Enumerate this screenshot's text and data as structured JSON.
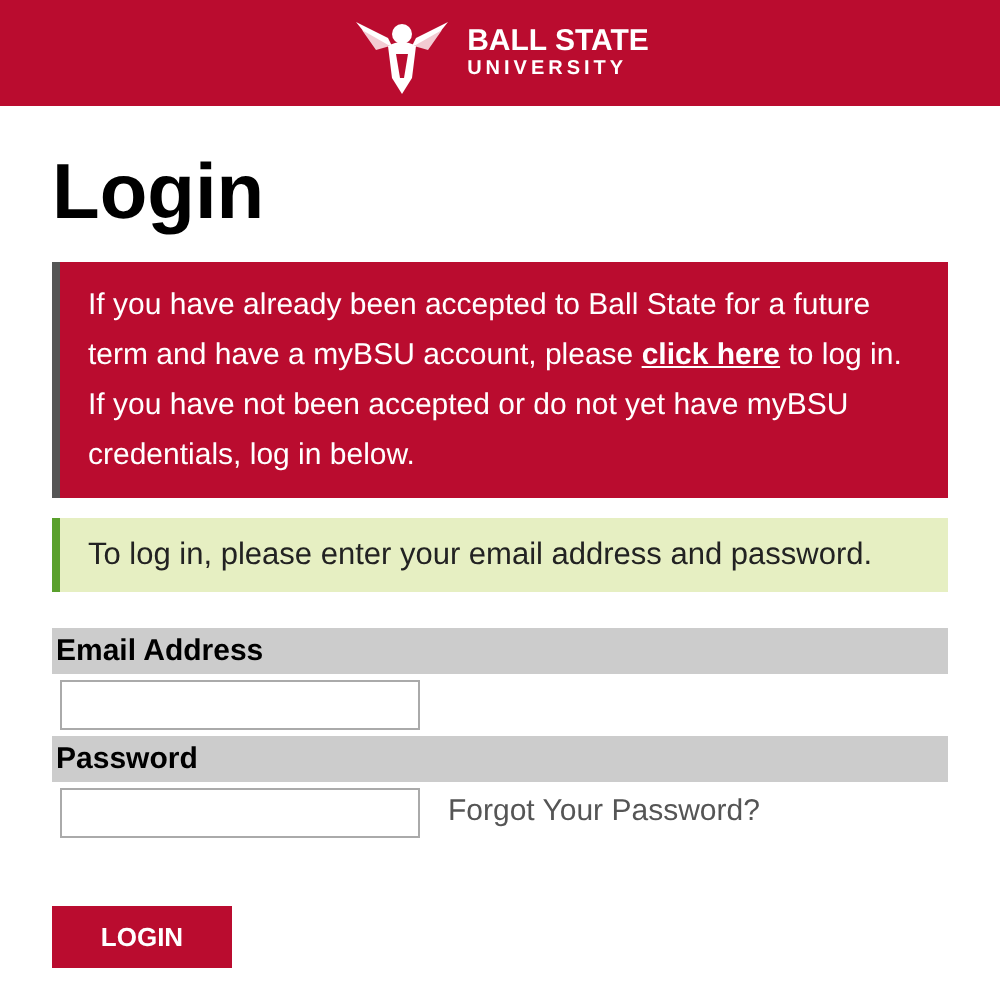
{
  "header": {
    "logo_line_1": "BALL STATE",
    "logo_line_2": "UNIVERSITY"
  },
  "title": "Login",
  "notice": {
    "text_before": "If you have already been accepted to Ball State for a future term and have a myBSU account, please ",
    "link": "click here",
    "text_after": " to log in. If you have not been accepted or do not yet have myBSU credentials, log in below."
  },
  "instructions": "To log in, please enter your email address and password.",
  "fields": [
    {
      "label": "Email Address"
    },
    {
      "label": "Password",
      "link": "Forgot Your Password?"
    }
  ],
  "button": "LOGIN"
}
